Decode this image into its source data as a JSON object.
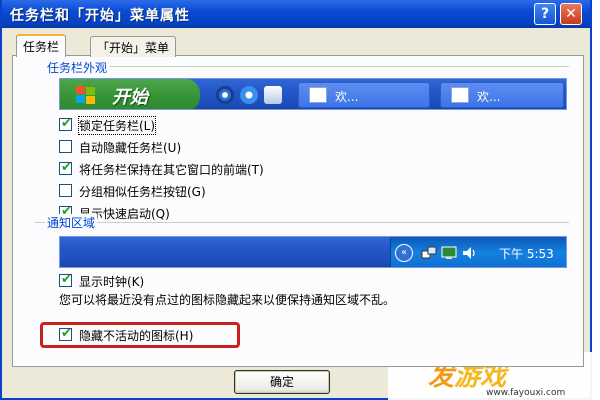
{
  "window": {
    "title": "任务栏和「开始」菜单属性",
    "help_glyph": "?",
    "close_glyph": "✕"
  },
  "tabs": [
    {
      "label": "任务栏",
      "active": true
    },
    {
      "label": "「开始」菜单",
      "active": false
    }
  ],
  "appearance": {
    "group_title": "任务栏外观",
    "preview": {
      "start_label": "开始",
      "task_buttons": [
        "欢...",
        "欢..."
      ]
    },
    "options": [
      {
        "label": "锁定任务栏(L)",
        "checked": true
      },
      {
        "label": "自动隐藏任务栏(U)",
        "checked": false
      },
      {
        "label": "将任务栏保持在其它窗口的前端(T)",
        "checked": true
      },
      {
        "label": "分组相似任务栏按钮(G)",
        "checked": false
      },
      {
        "label": "显示快速启动(Q)",
        "checked": true
      }
    ]
  },
  "notification": {
    "group_title": "通知区域",
    "clock_text": "下午 5:53",
    "tray_arrow": "«",
    "options": [
      {
        "label": "显示时钟(K)",
        "checked": true
      },
      {
        "label": "隐藏不活动的图标(H)",
        "checked": true
      }
    ],
    "description": "您可以将最近没有点过的图标隐藏起来以便保持通知区域不乱。"
  },
  "buttons": {
    "ok": "确定"
  },
  "watermark": {
    "brand_part1": "发",
    "brand_part2": "游戏",
    "url": "www.fayouxi.com"
  },
  "colors": {
    "title_bar": "#0a4ad4",
    "group_title": "#0046d5",
    "start_button": "#379637",
    "highlight": "#c8201f",
    "checkmark": "#21a121"
  }
}
